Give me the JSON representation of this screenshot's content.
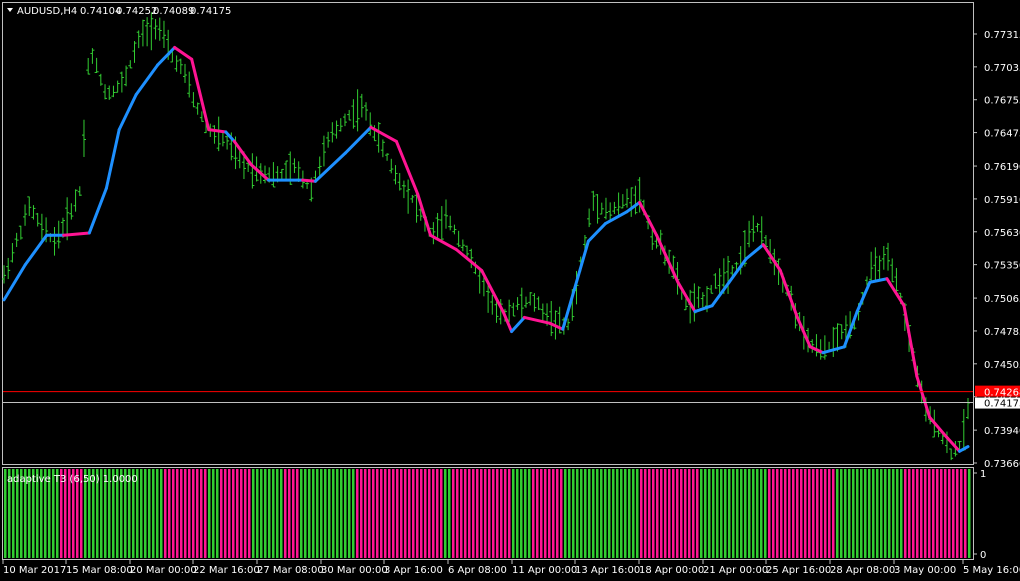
{
  "header": {
    "symbol": "AUDUSD,H4",
    "open": "0.74104",
    "high": "0.74252",
    "low": "0.74089",
    "close": "0.74175"
  },
  "indicator_label": "adaptive T3 (6,50) 1.0000",
  "colors": {
    "background": "#000000",
    "bars": "#32cd32",
    "t3_up": "#1e90ff",
    "t3_down": "#ff1493",
    "hist_up": "#32cd32",
    "hist_down": "#ff1493",
    "bid_line": "#c0c0c0",
    "ask_line": "#ff0000",
    "ask_label_bg": "#ff0000"
  },
  "chart_data": [
    {
      "type": "line",
      "title": "AUDUSD,H4",
      "y_ticks": [
        "0.77315",
        "0.77035",
        "0.76755",
        "0.76475",
        "0.76190",
        "0.75910",
        "0.75630",
        "0.75350",
        "0.75065",
        "0.74785",
        "0.74505",
        "0.74225",
        "0.73940",
        "0.73660"
      ],
      "ylim": [
        0.7366,
        0.77315
      ],
      "x_ticks": [
        "10 Mar 2017",
        "15 Mar 08:00",
        "20 Mar 00:00",
        "22 Mar 16:00",
        "27 Mar 08:00",
        "30 Mar 00:00",
        "3 Apr 16:00",
        "6 Apr 08:00",
        "11 Apr 00:00",
        "13 Apr 16:00",
        "18 Apr 00:00",
        "21 Apr 00:00",
        "25 Apr 16:00",
        "28 Apr 08:00",
        "3 May 00:00",
        "5 May 16:00"
      ],
      "bid_price": "0.74175",
      "ask_price": "0.74268",
      "series": [
        {
          "trend": [
            {
              "t": 0,
              "v": 0.7505,
              "dir": "up"
            },
            {
              "t": 5,
              "v": 0.7535,
              "dir": "up"
            },
            {
              "t": 10,
              "v": 0.756,
              "dir": "up"
            },
            {
              "t": 14,
              "v": 0.756,
              "dir": "down"
            },
            {
              "t": 20,
              "v": 0.7562,
              "dir": "up"
            },
            {
              "t": 24,
              "v": 0.76,
              "dir": "up"
            },
            {
              "t": 27,
              "v": 0.765,
              "dir": "up"
            },
            {
              "t": 31,
              "v": 0.768,
              "dir": "up"
            },
            {
              "t": 36,
              "v": 0.7705,
              "dir": "up"
            },
            {
              "t": 40,
              "v": 0.772,
              "dir": "down"
            },
            {
              "t": 44,
              "v": 0.771,
              "dir": "down"
            },
            {
              "t": 48,
              "v": 0.765,
              "dir": "down"
            },
            {
              "t": 52,
              "v": 0.7648,
              "dir": "up"
            },
            {
              "t": 54,
              "v": 0.764,
              "dir": "down"
            },
            {
              "t": 58,
              "v": 0.762,
              "dir": "down"
            },
            {
              "t": 62,
              "v": 0.7607,
              "dir": "up"
            },
            {
              "t": 70,
              "v": 0.7607,
              "dir": "down"
            },
            {
              "t": 73,
              "v": 0.7606,
              "dir": "up"
            },
            {
              "t": 80,
              "v": 0.763,
              "dir": "up"
            },
            {
              "t": 86,
              "v": 0.7652,
              "dir": "down"
            },
            {
              "t": 92,
              "v": 0.764,
              "dir": "down"
            },
            {
              "t": 97,
              "v": 0.7595,
              "dir": "down"
            },
            {
              "t": 100,
              "v": 0.756,
              "dir": "down"
            },
            {
              "t": 106,
              "v": 0.7548,
              "dir": "down"
            },
            {
              "t": 112,
              "v": 0.753,
              "dir": "down"
            },
            {
              "t": 117,
              "v": 0.7495,
              "dir": "down"
            },
            {
              "t": 119,
              "v": 0.7478,
              "dir": "up"
            },
            {
              "t": 122,
              "v": 0.749,
              "dir": "down"
            },
            {
              "t": 128,
              "v": 0.7485,
              "dir": "down"
            },
            {
              "t": 131,
              "v": 0.748,
              "dir": "up"
            },
            {
              "t": 137,
              "v": 0.7555,
              "dir": "up"
            },
            {
              "t": 141,
              "v": 0.757,
              "dir": "up"
            },
            {
              "t": 146,
              "v": 0.758,
              "dir": "up"
            },
            {
              "t": 149,
              "v": 0.7588,
              "dir": "down"
            },
            {
              "t": 153,
              "v": 0.756,
              "dir": "down"
            },
            {
              "t": 158,
              "v": 0.752,
              "dir": "down"
            },
            {
              "t": 162,
              "v": 0.7495,
              "dir": "up"
            },
            {
              "t": 166,
              "v": 0.75,
              "dir": "up"
            },
            {
              "t": 170,
              "v": 0.752,
              "dir": "up"
            },
            {
              "t": 174,
              "v": 0.754,
              "dir": "up"
            },
            {
              "t": 178,
              "v": 0.7552,
              "dir": "down"
            },
            {
              "t": 182,
              "v": 0.753,
              "dir": "down"
            },
            {
              "t": 186,
              "v": 0.749,
              "dir": "down"
            },
            {
              "t": 189,
              "v": 0.7465,
              "dir": "down"
            },
            {
              "t": 192,
              "v": 0.746,
              "dir": "up"
            },
            {
              "t": 197,
              "v": 0.7465,
              "dir": "up"
            },
            {
              "t": 200,
              "v": 0.7495,
              "dir": "up"
            },
            {
              "t": 203,
              "v": 0.752,
              "dir": "up"
            },
            {
              "t": 207,
              "v": 0.7523,
              "dir": "down"
            },
            {
              "t": 211,
              "v": 0.75,
              "dir": "down"
            },
            {
              "t": 214,
              "v": 0.744,
              "dir": "down"
            },
            {
              "t": 217,
              "v": 0.7405,
              "dir": "down"
            },
            {
              "t": 221,
              "v": 0.7388,
              "dir": "down"
            },
            {
              "t": 224,
              "v": 0.7376,
              "dir": "up"
            },
            {
              "t": 226,
              "v": 0.738,
              "dir": "up"
            }
          ],
          "price": [
            {
              "t": 0,
              "v": 0.7525
            },
            {
              "t": 3,
              "v": 0.7555
            },
            {
              "t": 6,
              "v": 0.7585
            },
            {
              "t": 9,
              "v": 0.7565
            },
            {
              "t": 12,
              "v": 0.7555
            },
            {
              "t": 15,
              "v": 0.7575
            },
            {
              "t": 18,
              "v": 0.76
            },
            {
              "t": 20,
              "v": 0.772
            },
            {
              "t": 24,
              "v": 0.768
            },
            {
              "t": 28,
              "v": 0.769
            },
            {
              "t": 32,
              "v": 0.773
            },
            {
              "t": 36,
              "v": 0.774
            },
            {
              "t": 39,
              "v": 0.7715
            },
            {
              "t": 42,
              "v": 0.77
            },
            {
              "t": 45,
              "v": 0.767
            },
            {
              "t": 48,
              "v": 0.765
            },
            {
              "t": 52,
              "v": 0.764
            },
            {
              "t": 56,
              "v": 0.762
            },
            {
              "t": 60,
              "v": 0.7615
            },
            {
              "t": 64,
              "v": 0.761
            },
            {
              "t": 68,
              "v": 0.7618
            },
            {
              "t": 72,
              "v": 0.76
            },
            {
              "t": 76,
              "v": 0.764
            },
            {
              "t": 80,
              "v": 0.766
            },
            {
              "t": 84,
              "v": 0.767
            },
            {
              "t": 88,
              "v": 0.764
            },
            {
              "t": 92,
              "v": 0.761
            },
            {
              "t": 96,
              "v": 0.759
            },
            {
              "t": 100,
              "v": 0.756
            },
            {
              "t": 104,
              "v": 0.7575
            },
            {
              "t": 108,
              "v": 0.755
            },
            {
              "t": 112,
              "v": 0.752
            },
            {
              "t": 116,
              "v": 0.749
            },
            {
              "t": 120,
              "v": 0.75
            },
            {
              "t": 124,
              "v": 0.7505
            },
            {
              "t": 128,
              "v": 0.749
            },
            {
              "t": 132,
              "v": 0.748
            },
            {
              "t": 135,
              "v": 0.753
            },
            {
              "t": 138,
              "v": 0.759
            },
            {
              "t": 142,
              "v": 0.758
            },
            {
              "t": 146,
              "v": 0.759
            },
            {
              "t": 149,
              "v": 0.7595
            },
            {
              "t": 152,
              "v": 0.756
            },
            {
              "t": 156,
              "v": 0.754
            },
            {
              "t": 160,
              "v": 0.75
            },
            {
              "t": 164,
              "v": 0.7505
            },
            {
              "t": 168,
              "v": 0.7525
            },
            {
              "t": 172,
              "v": 0.7535
            },
            {
              "t": 176,
              "v": 0.757
            },
            {
              "t": 180,
              "v": 0.7545
            },
            {
              "t": 184,
              "v": 0.751
            },
            {
              "t": 188,
              "v": 0.747
            },
            {
              "t": 192,
              "v": 0.746
            },
            {
              "t": 196,
              "v": 0.7475
            },
            {
              "t": 200,
              "v": 0.749
            },
            {
              "t": 203,
              "v": 0.753
            },
            {
              "t": 207,
              "v": 0.754
            },
            {
              "t": 210,
              "v": 0.751
            },
            {
              "t": 213,
              "v": 0.746
            },
            {
              "t": 216,
              "v": 0.741
            },
            {
              "t": 219,
              "v": 0.7395
            },
            {
              "t": 222,
              "v": 0.7375
            },
            {
              "t": 224,
              "v": 0.738
            },
            {
              "t": 226,
              "v": 0.741
            }
          ]
        }
      ]
    },
    {
      "type": "bar",
      "title": "adaptive T3 (6,50) 1.0000",
      "y_ticks": [
        "1",
        "0"
      ],
      "ylim": [
        0,
        1
      ],
      "segments": [
        {
          "start": 0,
          "end": 14,
          "dir": "up"
        },
        {
          "start": 14,
          "end": 20,
          "dir": "down"
        },
        {
          "start": 20,
          "end": 40,
          "dir": "up"
        },
        {
          "start": 40,
          "end": 51,
          "dir": "down"
        },
        {
          "start": 51,
          "end": 54,
          "dir": "up"
        },
        {
          "start": 54,
          "end": 62,
          "dir": "down"
        },
        {
          "start": 62,
          "end": 70,
          "dir": "up"
        },
        {
          "start": 70,
          "end": 74,
          "dir": "down"
        },
        {
          "start": 74,
          "end": 88,
          "dir": "up"
        },
        {
          "start": 88,
          "end": 110,
          "dir": "down"
        },
        {
          "start": 110,
          "end": 112,
          "dir": "up"
        },
        {
          "start": 112,
          "end": 127,
          "dir": "down"
        },
        {
          "start": 127,
          "end": 132,
          "dir": "up"
        },
        {
          "start": 132,
          "end": 140,
          "dir": "down"
        },
        {
          "start": 140,
          "end": 159,
          "dir": "up"
        },
        {
          "start": 159,
          "end": 174,
          "dir": "down"
        },
        {
          "start": 174,
          "end": 191,
          "dir": "up"
        },
        {
          "start": 191,
          "end": 208,
          "dir": "down"
        },
        {
          "start": 208,
          "end": 225,
          "dir": "up"
        },
        {
          "start": 225,
          "end": 241,
          "dir": "down"
        },
        {
          "start": 241,
          "end": 242,
          "dir": "up"
        }
      ]
    }
  ]
}
